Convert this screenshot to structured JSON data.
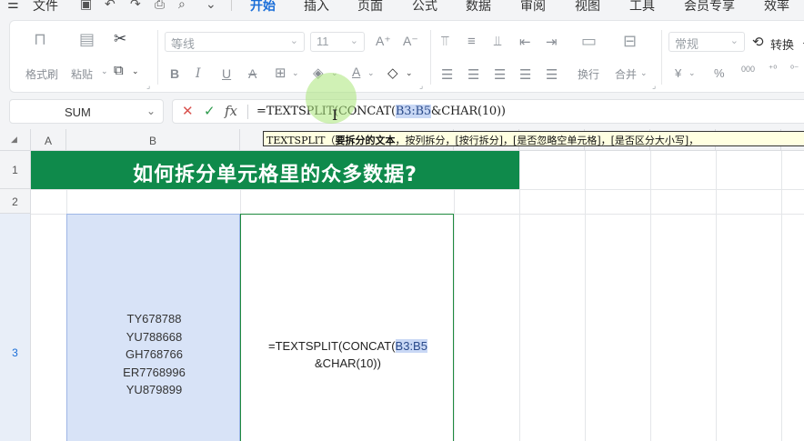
{
  "menu": {
    "hamburger": "☰",
    "file": "文件",
    "tabs": [
      "开始",
      "插入",
      "页面",
      "公式",
      "数据",
      "审阅",
      "视图",
      "工具",
      "会员专享",
      "效率"
    ],
    "active_tab": "开始"
  },
  "ribbon": {
    "format_painter": "格式刷",
    "paste": "粘贴",
    "font_name": "等线",
    "font_size": "11",
    "number_format": "常规",
    "convert": "转换",
    "wrap": "换行",
    "merge": "合并",
    "currency": "¥",
    "percent": "%",
    "thousands": "000"
  },
  "formula_bar": {
    "name_box": "SUM",
    "formula_prefix": "=TEXTSPLIT(CONCAT(",
    "formula_ref": "B3:B5",
    "formula_suffix": "&CHAR(10))"
  },
  "tooltip": {
    "func": "TEXTSPLIT（",
    "arg_bold": "要拆分的文本",
    "rest": "，按列拆分，[按行拆分]，[是否忽略空单元格]，[是否区分大小写]，"
  },
  "grid": {
    "corner_mark": "◢",
    "columns": [
      "A",
      "B"
    ],
    "rows": [
      "1",
      "2",
      "3"
    ],
    "title": "如何拆分单元格里的众多数据?",
    "b3_values": [
      "TY678788",
      "YU788668",
      "GH768766",
      "ER7768996",
      "YU879899"
    ],
    "c3_line1_prefix": "=TEXTSPLIT(CONCAT(",
    "c3_line1_ref": "B3:B5",
    "c3_line2": "&CHAR(10))"
  }
}
